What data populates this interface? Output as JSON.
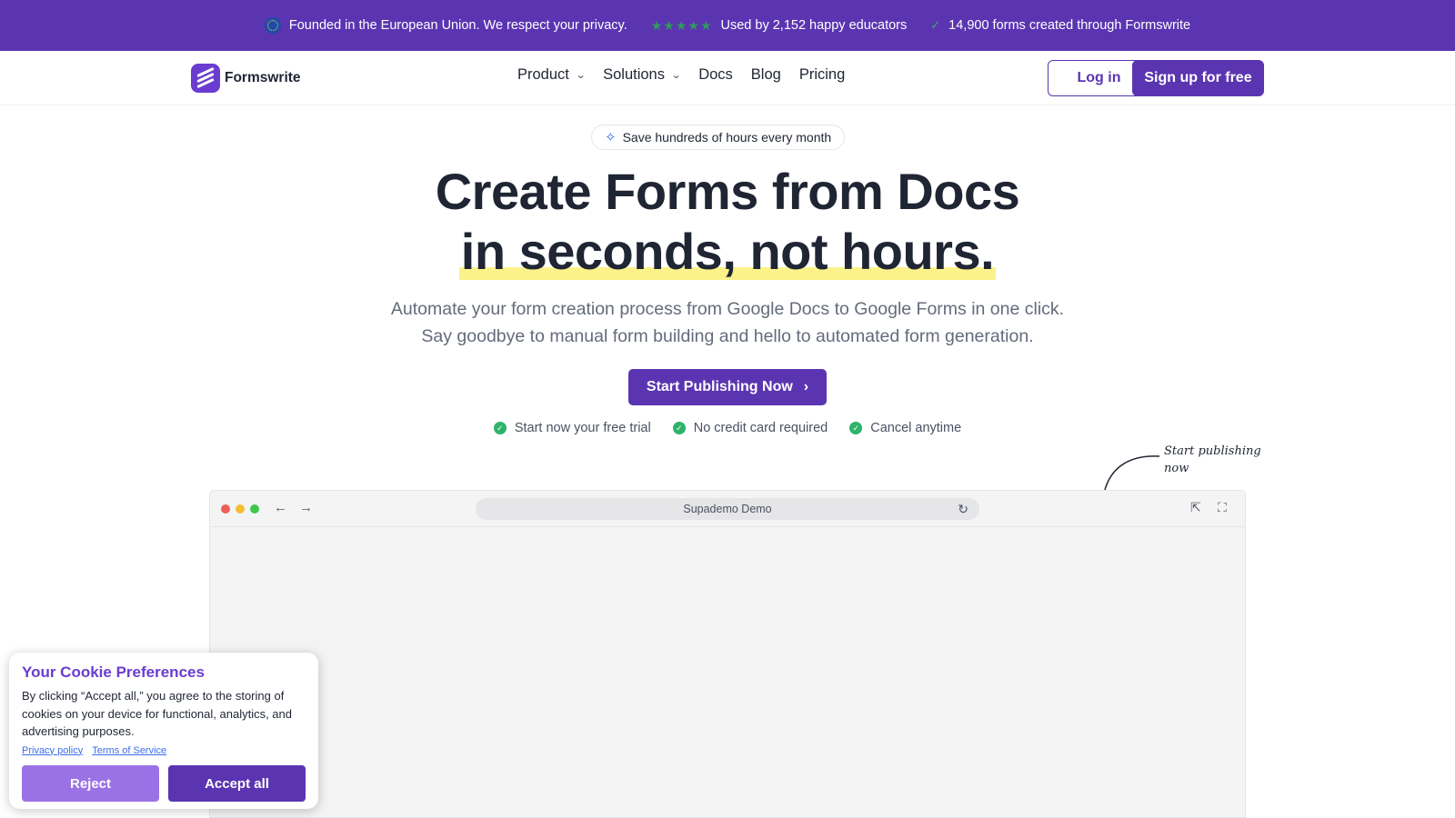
{
  "topbar": {
    "eu_text": "Founded in the European Union. We respect your privacy.",
    "stars": "★★★★★",
    "educators_text": "Used by 2,152 happy educators",
    "forms_text": "14,900 forms created through Formswrite"
  },
  "nav": {
    "brand": "Formswrite",
    "links": [
      "Product",
      "Solutions",
      "Docs",
      "Blog",
      "Pricing"
    ],
    "login": "Log in",
    "signup": "Sign up for free"
  },
  "hero": {
    "badge": "Save hundreds of hours every month",
    "title_line1": "Create Forms from Docs",
    "title_line2": "in seconds, not hours.",
    "subtitle_line1": "Automate your form creation process from Google Docs to Google Forms in one click.",
    "subtitle_line2": "Say goodbye to manual form building and hello to automated form generation.",
    "cta": "Start Publishing Now",
    "perks": [
      "Start now your free trial",
      "No credit card required",
      "Cancel anytime"
    ],
    "annotation_line1": "Start publishing",
    "annotation_line2": "now"
  },
  "demo": {
    "url_label": "Supademo Demo"
  },
  "cookie": {
    "title": "Your Cookie Preferences",
    "body": "By clicking “Accept all,” you agree to the storing of cookies on your device for functional, analytics, and advertising purposes.",
    "privacy": "Privacy policy",
    "terms": "Terms of Service",
    "reject": "Reject",
    "accept": "Accept all"
  },
  "colors": {
    "brand": "#5b35b1",
    "reject_bg": "#9b72e6",
    "accept_bg": "#5b35b1",
    "highlight": "#fbf28a"
  }
}
